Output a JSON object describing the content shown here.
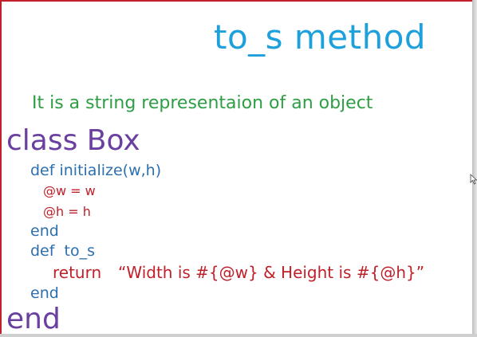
{
  "slide": {
    "title": "to_s method",
    "subtitle": "It is a string representaion of an object",
    "code": {
      "line1": "class Box",
      "line2": "def initialize(w,h)",
      "line3": "@w = w",
      "line4": "@h = h",
      "line5": "end",
      "line6": "def  to_s",
      "line7_keyword": "return",
      "line7_string": "“Width is #{@w} & Height is #{@h}”",
      "line8": "end",
      "line9": "end"
    }
  },
  "colors": {
    "title": "#1ea0dc",
    "subtitle": "#2e9e44",
    "class_keyword": "#6b3fa0",
    "method_code": "#2c6fae",
    "body_code": "#c0202a",
    "border": "#c0202a"
  },
  "icons": {
    "cursor": "mouse-pointer-icon"
  }
}
